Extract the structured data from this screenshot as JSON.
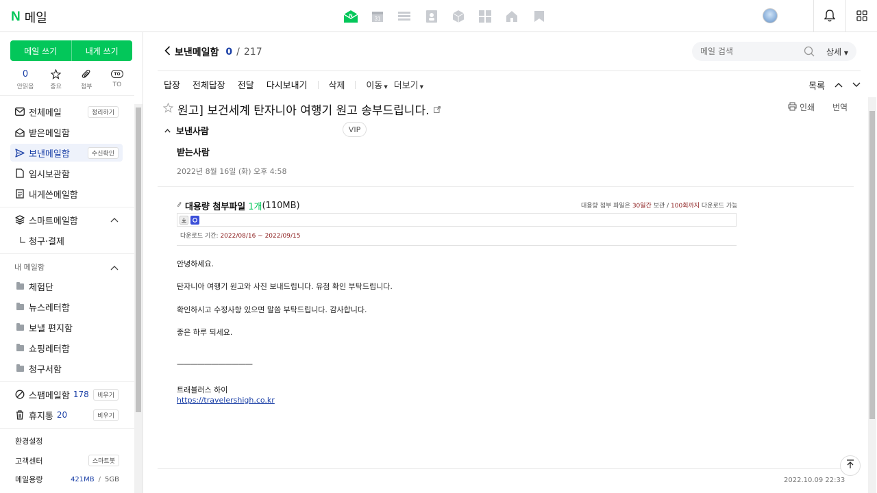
{
  "topbar": {
    "logo_n": "N",
    "logo_text": "메일",
    "apps": [
      "mail-app-icon",
      "calendar-app-icon",
      "list-app-icon",
      "contacts-app-icon",
      "box-app-icon",
      "grid-app-icon",
      "home-app-icon",
      "bookmark-app-icon"
    ],
    "calendar_day": "31"
  },
  "sidebar": {
    "write_button": "메일 쓰기",
    "self_write_button": "내게 쓰기",
    "quick": {
      "unread_count": "0",
      "unread_label": "안읽음",
      "important_label": "중요",
      "attach_label": "첨부",
      "to_badge": "TO",
      "to_label": "TO"
    },
    "folders": {
      "all": "전체메일",
      "all_pill": "정리하기",
      "inbox": "받은메일함",
      "sent": "보낸메일함",
      "sent_pill": "수신확인",
      "drafts": "임시보관함",
      "self": "내게쓴메일함",
      "smart": "스마트메일함",
      "billing": "청구·결제"
    },
    "my_section": "내 메일함",
    "my_folders": [
      "체험단",
      "뉴스레터함",
      "보낼 편지함",
      "쇼핑레터함",
      "청구서함"
    ],
    "spam": "스팸메일함",
    "spam_count": "178",
    "spam_pill": "비우기",
    "trash": "휴지통",
    "trash_count": "20",
    "trash_pill": "비우기",
    "settings": "환경설정",
    "support": "고객센터",
    "smartbot_pill": "스마트봇",
    "storage_label": "메일용량",
    "storage_used": "421MB",
    "storage_sep": "/",
    "storage_total": "5GB"
  },
  "header": {
    "folder_name": "보낸메일함",
    "unread": "0",
    "sep": "/",
    "total": "217",
    "search_placeholder": "메일 검색",
    "detail": "상세"
  },
  "toolbar": {
    "reply": "답장",
    "reply_all": "전체답장",
    "forward": "전달",
    "resend": "다시보내기",
    "delete": "삭제",
    "move": "이동",
    "more": "더보기",
    "list": "목록"
  },
  "mail": {
    "subject": "원고] 보건세계 탄자니아 여행기 원고 송부드립니다.",
    "print": "인쇄",
    "translate": "번역",
    "sender_label": "보낸사람",
    "vip": "VIP",
    "recipient_label": "받는사람",
    "date": "2022년 8월 16일 (화) 오후 4:58",
    "attachment": {
      "title": "대용량 첨부파일",
      "count": "1개",
      "size": "(110MB)",
      "note_prefix": "대용량 첨부 파일은 ",
      "note_days": "30일간",
      "note_mid": " 보관 / ",
      "note_times": "100회까지",
      "note_suffix": " 다운로드 가능",
      "period_label": "다운로드 기간: ",
      "period": "2022/08/16 ~ 2022/09/15"
    },
    "body": [
      "안녕하세요.",
      "탄자니아 여행기 원고와 사진 보내드립니다. 유첨 확인 부탁드립니다.",
      "확인하시고 수정사항 있으면 말씀 부탁드립니다. 감사합니다.",
      "좋은 하루 되세요."
    ],
    "signature_line": "———————————",
    "signature_name": "트래블러스 하이",
    "signature_link": "https://travelershigh.co.kr",
    "footer_time": "2022.10.09 22:33"
  }
}
